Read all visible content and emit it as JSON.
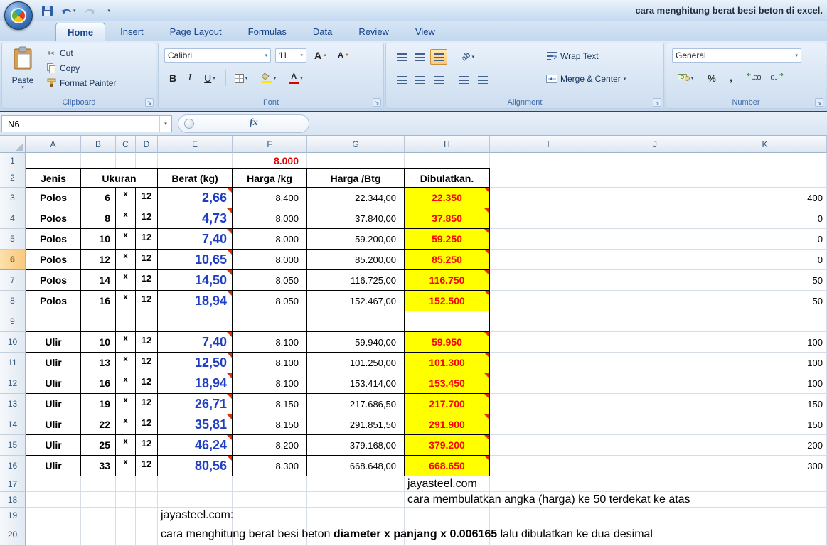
{
  "window": {
    "title": "cara menghitung berat besi beton di excel."
  },
  "tabs": [
    {
      "label": "Home",
      "active": true
    },
    {
      "label": "Insert"
    },
    {
      "label": "Page Layout"
    },
    {
      "label": "Formulas"
    },
    {
      "label": "Data"
    },
    {
      "label": "Review"
    },
    {
      "label": "View"
    }
  ],
  "ribbon": {
    "clipboard": {
      "group_label": "Clipboard",
      "paste": "Paste",
      "cut": "Cut",
      "copy": "Copy",
      "format_painter": "Format Painter"
    },
    "font": {
      "group_label": "Font",
      "font_name": "Calibri",
      "font_size": "11",
      "bold": "B",
      "italic": "I",
      "underline": "U",
      "grow_letter": "A",
      "shrink_letter": "A",
      "font_color_letter": "A"
    },
    "alignment": {
      "group_label": "Alignment",
      "wrap_text": "Wrap Text",
      "merge_center": "Merge & Center"
    },
    "number": {
      "group_label": "Number",
      "format": "General",
      "percent": "%",
      "comma": ","
    }
  },
  "formula_bar": {
    "name_box": "N6",
    "fx": "fx"
  },
  "icons": {
    "dropdown_arrow": "▾",
    "scissors": "✂",
    "dialog_launcher": "↘",
    "arrow_up": "▲",
    "arrow_down": "▼",
    "orientation": "ab"
  },
  "colors": {
    "fill_color": "#FFE800",
    "font_color": "#E00000",
    "highlight_yellow": "#FFFF00",
    "rounded_red": "#FF0000",
    "weight_blue": "#1F3EC3"
  },
  "sheet": {
    "columns": [
      "A",
      "B",
      "C",
      "D",
      "E",
      "F",
      "G",
      "H",
      "I",
      "J",
      "K"
    ],
    "row_count": 20,
    "selected_row": 6,
    "f1_value": "8.000",
    "headers": {
      "jenis": "Jenis",
      "ukuran": "Ukuran",
      "berat": "Berat (kg)",
      "harga_kg": "Harga /kg",
      "harga_btg": "Harga /Btg",
      "dibulatkan": "Dibulatkan."
    },
    "rows": [
      {
        "row": 3,
        "jenis": "Polos",
        "dia": "6",
        "x": "x",
        "len": "12",
        "berat": "2,66",
        "harga_kg": "8.400",
        "harga_btg": "22.344,00",
        "bulat": "22.350",
        "k": "400"
      },
      {
        "row": 4,
        "jenis": "Polos",
        "dia": "8",
        "x": "x",
        "len": "12",
        "berat": "4,73",
        "harga_kg": "8.000",
        "harga_btg": "37.840,00",
        "bulat": "37.850",
        "k": "0"
      },
      {
        "row": 5,
        "jenis": "Polos",
        "dia": "10",
        "x": "x",
        "len": "12",
        "berat": "7,40",
        "harga_kg": "8.000",
        "harga_btg": "59.200,00",
        "bulat": "59.250",
        "k": "0"
      },
      {
        "row": 6,
        "jenis": "Polos",
        "dia": "12",
        "x": "x",
        "len": "12",
        "berat": "10,65",
        "harga_kg": "8.000",
        "harga_btg": "85.200,00",
        "bulat": "85.250",
        "k": "0"
      },
      {
        "row": 7,
        "jenis": "Polos",
        "dia": "14",
        "x": "x",
        "len": "12",
        "berat": "14,50",
        "harga_kg": "8.050",
        "harga_btg": "116.725,00",
        "bulat": "116.750",
        "k": "50"
      },
      {
        "row": 8,
        "jenis": "Polos",
        "dia": "16",
        "x": "x",
        "len": "12",
        "berat": "18,94",
        "harga_kg": "8.050",
        "harga_btg": "152.467,00",
        "bulat": "152.500",
        "k": "50"
      },
      {
        "row": 9,
        "empty": true
      },
      {
        "row": 10,
        "jenis": "Ulir",
        "dia": "10",
        "x": "x",
        "len": "12",
        "berat": "7,40",
        "harga_kg": "8.100",
        "harga_btg": "59.940,00",
        "bulat": "59.950",
        "k": "100"
      },
      {
        "row": 11,
        "jenis": "Ulir",
        "dia": "13",
        "x": "x",
        "len": "12",
        "berat": "12,50",
        "harga_kg": "8.100",
        "harga_btg": "101.250,00",
        "bulat": "101.300",
        "k": "100"
      },
      {
        "row": 12,
        "jenis": "Ulir",
        "dia": "16",
        "x": "x",
        "len": "12",
        "berat": "18,94",
        "harga_kg": "8.100",
        "harga_btg": "153.414,00",
        "bulat": "153.450",
        "k": "100"
      },
      {
        "row": 13,
        "jenis": "Ulir",
        "dia": "19",
        "x": "x",
        "len": "12",
        "berat": "26,71",
        "harga_kg": "8.150",
        "harga_btg": "217.686,50",
        "bulat": "217.700",
        "k": "150"
      },
      {
        "row": 14,
        "jenis": "Ulir",
        "dia": "22",
        "x": "x",
        "len": "12",
        "berat": "35,81",
        "harga_kg": "8.150",
        "harga_btg": "291.851,50",
        "bulat": "291.900",
        "k": "150"
      },
      {
        "row": 15,
        "jenis": "Ulir",
        "dia": "25",
        "x": "x",
        "len": "12",
        "berat": "46,24",
        "harga_kg": "8.200",
        "harga_btg": "379.168,00",
        "bulat": "379.200",
        "k": "200"
      },
      {
        "row": 16,
        "jenis": "Ulir",
        "dia": "33",
        "x": "x",
        "len": "12",
        "berat": "80,56",
        "harga_kg": "8.300",
        "harga_btg": "668.648,00",
        "bulat": "668.650",
        "k": "300"
      }
    ],
    "notes": {
      "h17": "jayasteel.com",
      "h18": "cara membulatkan angka (harga) ke 50 terdekat ke atas",
      "e19": "jayasteel.com:",
      "e20_parts": [
        "cara menghitung berat besi beton ",
        "diameter x panjang x 0.006165",
        " lalu dibulatkan ke dua desimal"
      ]
    }
  }
}
